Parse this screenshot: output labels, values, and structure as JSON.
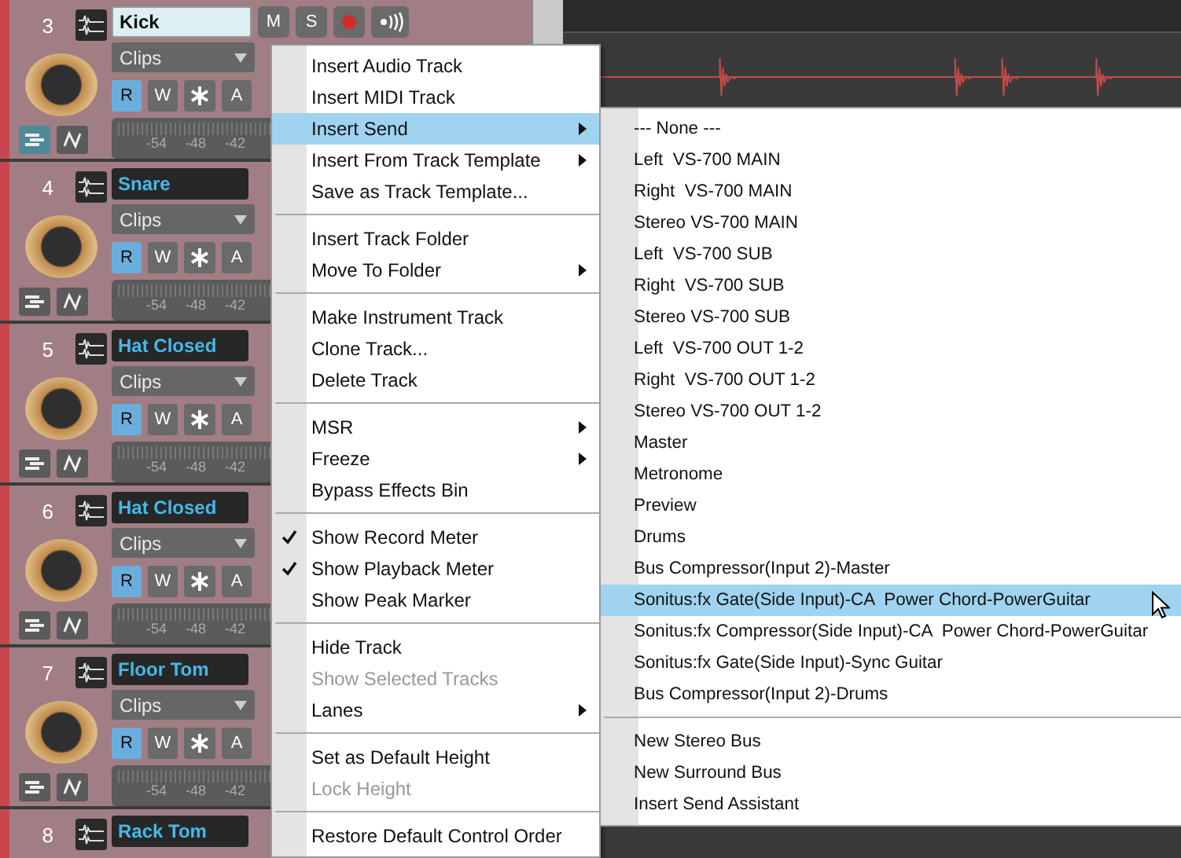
{
  "tracks": [
    {
      "number": "3",
      "name": "Kick",
      "editing": true,
      "buttons": [
        "M",
        "S"
      ],
      "lane_button_on": true,
      "clips": "Clips",
      "rw": [
        {
          "label": "R",
          "selected": true
        },
        {
          "label": "W",
          "selected": false
        },
        {
          "label": "A",
          "selected": false
        }
      ],
      "meter_labels": [
        "-54",
        "-48",
        "-42"
      ]
    },
    {
      "number": "4",
      "name": "Snare",
      "editing": false,
      "lane_button_on": false,
      "clips": "Clips",
      "rw": [
        {
          "label": "R",
          "selected": true
        },
        {
          "label": "W",
          "selected": false
        },
        {
          "label": "A",
          "selected": false
        }
      ],
      "meter_labels": [
        "-54",
        "-48",
        "-42"
      ]
    },
    {
      "number": "5",
      "name": "Hat Closed",
      "editing": false,
      "lane_button_on": false,
      "clips": "Clips",
      "rw": [
        {
          "label": "R",
          "selected": true
        },
        {
          "label": "W",
          "selected": false
        },
        {
          "label": "A",
          "selected": false
        }
      ],
      "meter_labels": [
        "-54",
        "-48",
        "-42"
      ]
    },
    {
      "number": "6",
      "name": "Hat Closed",
      "editing": false,
      "lane_button_on": false,
      "clips": "Clips",
      "rw": [
        {
          "label": "R",
          "selected": true
        },
        {
          "label": "W",
          "selected": false
        },
        {
          "label": "A",
          "selected": false
        }
      ],
      "meter_labels": [
        "-54",
        "-48",
        "-42"
      ]
    },
    {
      "number": "7",
      "name": "Floor Tom",
      "editing": false,
      "lane_button_on": false,
      "clips": "Clips",
      "rw": [
        {
          "label": "R",
          "selected": true
        },
        {
          "label": "W",
          "selected": false
        },
        {
          "label": "A",
          "selected": false
        }
      ],
      "meter_labels": [
        "-54",
        "-48",
        "-42"
      ]
    },
    {
      "number": "8",
      "name": "Rack Tom",
      "editing": false
    }
  ],
  "context_menu": {
    "items": [
      {
        "kind": "item",
        "label": "Insert Audio Track",
        "selected": false,
        "disabled": false,
        "checked": false,
        "submenu": false
      },
      {
        "kind": "item",
        "label": "Insert MIDI Track",
        "selected": false,
        "disabled": false,
        "checked": false,
        "submenu": false
      },
      {
        "kind": "item",
        "label": "Insert Send",
        "selected": true,
        "disabled": false,
        "checked": false,
        "submenu": true
      },
      {
        "kind": "item",
        "label": "Insert From Track Template",
        "selected": false,
        "disabled": false,
        "checked": false,
        "submenu": true
      },
      {
        "kind": "item",
        "label": "Save as Track Template...",
        "selected": false,
        "disabled": false,
        "checked": false,
        "submenu": false
      },
      {
        "kind": "separator"
      },
      {
        "kind": "item",
        "label": "Insert Track Folder",
        "selected": false,
        "disabled": false,
        "checked": false,
        "submenu": false
      },
      {
        "kind": "item",
        "label": "Move To Folder",
        "selected": false,
        "disabled": false,
        "checked": false,
        "submenu": true
      },
      {
        "kind": "separator"
      },
      {
        "kind": "item",
        "label": "Make Instrument Track",
        "selected": false,
        "disabled": false,
        "checked": false,
        "submenu": false
      },
      {
        "kind": "item",
        "label": "Clone Track...",
        "selected": false,
        "disabled": false,
        "checked": false,
        "submenu": false
      },
      {
        "kind": "item",
        "label": "Delete Track",
        "selected": false,
        "disabled": false,
        "checked": false,
        "submenu": false
      },
      {
        "kind": "separator"
      },
      {
        "kind": "item",
        "label": "MSR",
        "selected": false,
        "disabled": false,
        "checked": false,
        "submenu": true
      },
      {
        "kind": "item",
        "label": "Freeze",
        "selected": false,
        "disabled": false,
        "checked": false,
        "submenu": true
      },
      {
        "kind": "item",
        "label": "Bypass Effects Bin",
        "selected": false,
        "disabled": false,
        "checked": false,
        "submenu": false
      },
      {
        "kind": "separator"
      },
      {
        "kind": "item",
        "label": "Show Record Meter",
        "selected": false,
        "disabled": false,
        "checked": true,
        "submenu": false
      },
      {
        "kind": "item",
        "label": "Show Playback Meter",
        "selected": false,
        "disabled": false,
        "checked": true,
        "submenu": false
      },
      {
        "kind": "item",
        "label": "Show Peak Marker",
        "selected": false,
        "disabled": false,
        "checked": false,
        "submenu": false
      },
      {
        "kind": "separator"
      },
      {
        "kind": "item",
        "label": "Hide Track",
        "selected": false,
        "disabled": false,
        "checked": false,
        "submenu": false
      },
      {
        "kind": "item",
        "label": "Show Selected Tracks",
        "selected": false,
        "disabled": true,
        "checked": false,
        "submenu": false
      },
      {
        "kind": "item",
        "label": "Lanes",
        "selected": false,
        "disabled": false,
        "checked": false,
        "submenu": true
      },
      {
        "kind": "separator"
      },
      {
        "kind": "item",
        "label": "Set as Default Height",
        "selected": false,
        "disabled": false,
        "checked": false,
        "submenu": false
      },
      {
        "kind": "item",
        "label": "Lock Height",
        "selected": false,
        "disabled": true,
        "checked": false,
        "submenu": false
      },
      {
        "kind": "separator"
      },
      {
        "kind": "item",
        "label": "Restore Default Control Order",
        "selected": false,
        "disabled": false,
        "checked": false,
        "submenu": false
      }
    ]
  },
  "send_submenu": {
    "items": [
      {
        "kind": "item",
        "label": "--- None ---",
        "selected": false
      },
      {
        "kind": "item",
        "label": "Left  VS-700 MAIN",
        "selected": false
      },
      {
        "kind": "item",
        "label": "Right  VS-700 MAIN",
        "selected": false
      },
      {
        "kind": "item",
        "label": "Stereo VS-700 MAIN",
        "selected": false
      },
      {
        "kind": "item",
        "label": "Left  VS-700 SUB",
        "selected": false
      },
      {
        "kind": "item",
        "label": "Right  VS-700 SUB",
        "selected": false
      },
      {
        "kind": "item",
        "label": "Stereo VS-700 SUB",
        "selected": false
      },
      {
        "kind": "item",
        "label": "Left  VS-700 OUT 1-2",
        "selected": false
      },
      {
        "kind": "item",
        "label": "Right  VS-700 OUT 1-2",
        "selected": false
      },
      {
        "kind": "item",
        "label": "Stereo VS-700 OUT 1-2",
        "selected": false
      },
      {
        "kind": "item",
        "label": "Master",
        "selected": false
      },
      {
        "kind": "item",
        "label": "Metronome",
        "selected": false
      },
      {
        "kind": "item",
        "label": "Preview",
        "selected": false
      },
      {
        "kind": "item",
        "label": "Drums",
        "selected": false
      },
      {
        "kind": "item",
        "label": "Bus Compressor(Input 2)-Master",
        "selected": false
      },
      {
        "kind": "item",
        "label": "Sonitus:fx Gate(Side Input)-CA  Power Chord-PowerGuitar",
        "selected": true
      },
      {
        "kind": "item",
        "label": "Sonitus:fx Compressor(Side Input)-CA  Power Chord-PowerGuitar",
        "selected": false
      },
      {
        "kind": "item",
        "label": "Sonitus:fx Gate(Side Input)-Sync Guitar",
        "selected": false
      },
      {
        "kind": "item",
        "label": "Bus Compressor(Input 2)-Drums",
        "selected": false
      },
      {
        "kind": "separator"
      },
      {
        "kind": "item",
        "label": "New Stereo Bus",
        "selected": false
      },
      {
        "kind": "item",
        "label": "New Surround Bus",
        "selected": false
      },
      {
        "kind": "item",
        "label": "Insert Send Assistant",
        "selected": false
      }
    ]
  }
}
